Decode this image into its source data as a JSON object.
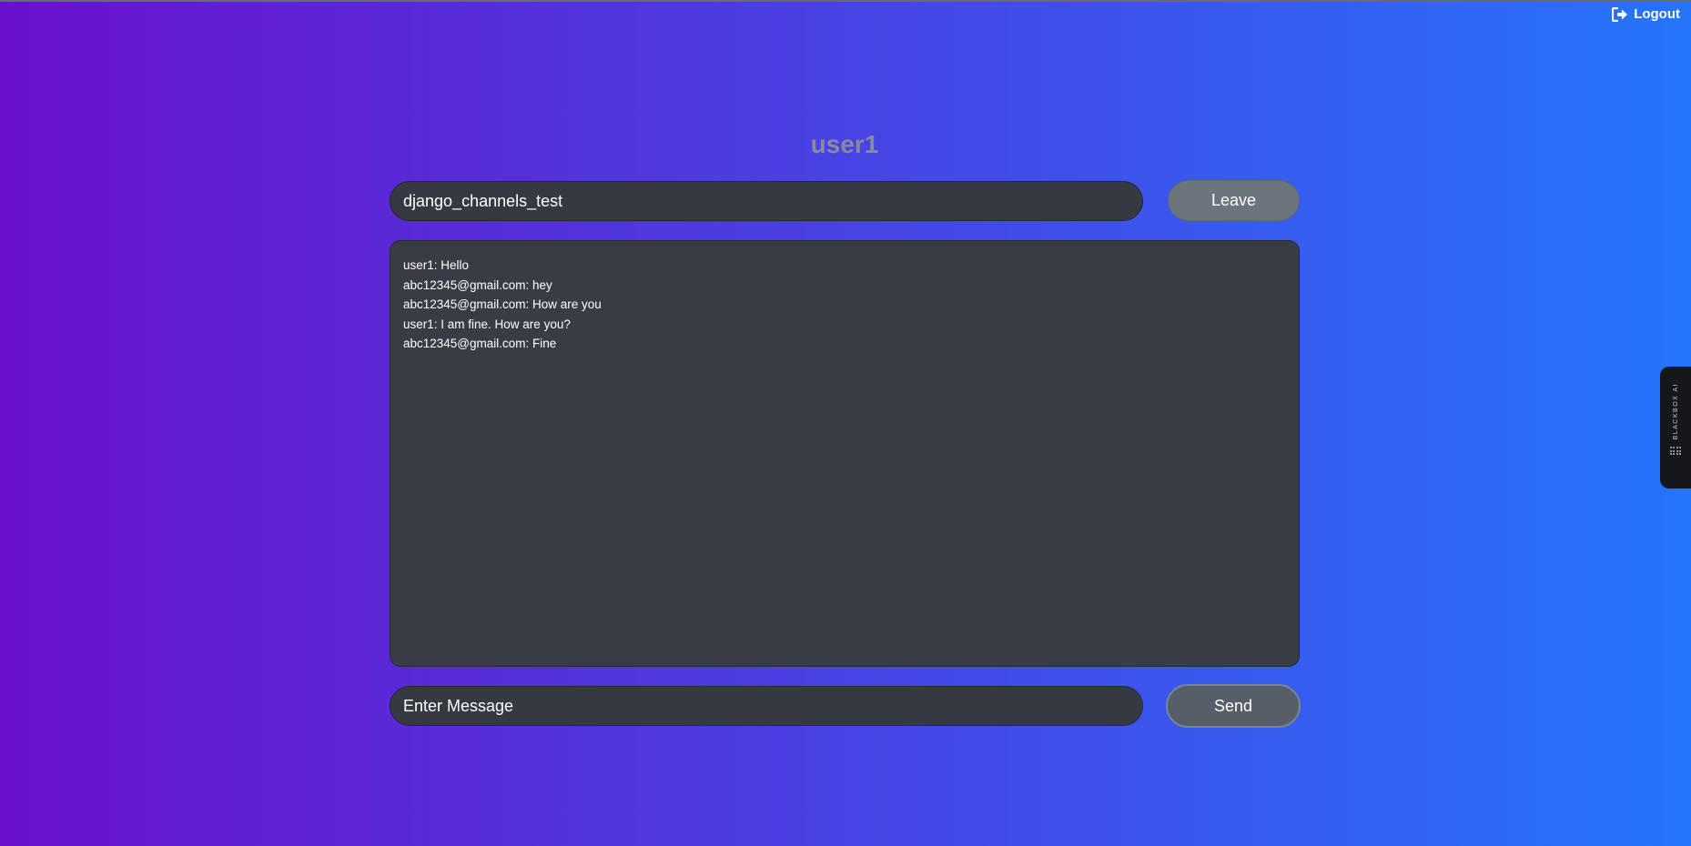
{
  "header": {
    "logout_label": "Logout",
    "logout_icon": "logout-icon"
  },
  "room": {
    "username": "user1",
    "room_name": "django_channels_test",
    "leave_label": "Leave"
  },
  "chat": {
    "messages": [
      "user1: Hello",
      "abc12345@gmail.com: hey",
      "abc12345@gmail.com: How are you",
      "user1: I am fine. How are you?",
      "abc12345@gmail.com: Fine"
    ]
  },
  "composer": {
    "message_value": "Enter Message",
    "send_label": "Send"
  },
  "side_widget": {
    "label": "BLACKBOX AI",
    "icon": "blackbox-logo-icon"
  },
  "colors": {
    "gradient_start": "#6a11cb",
    "gradient_end": "#2575fc",
    "panel": "#383c45",
    "leave_button": "#6c757d",
    "send_button": "#565e67"
  }
}
